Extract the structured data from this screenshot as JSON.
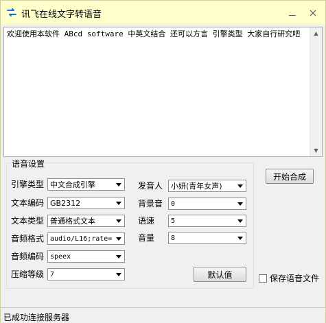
{
  "window": {
    "title": "讯飞在线文字转语音",
    "minimize_glyph": "—",
    "close_glyph": "✕"
  },
  "text_input": {
    "value": "欢迎使用本软件 ABcd software 中英文结合 还可以方言 引擎类型 大家自行研究吧"
  },
  "settings": {
    "group_title": "语音设置",
    "engine": {
      "label": "引擎类型",
      "value": "中文合成引擎"
    },
    "encoding": {
      "label": "文本编码",
      "value": "GB2312"
    },
    "text_type": {
      "label": "文本类型",
      "value": "普通格式文本"
    },
    "audio_format": {
      "label": "音频格式",
      "value": "audio/L16;rate="
    },
    "audio_codec": {
      "label": "音频编码",
      "value": "speex"
    },
    "compress_level": {
      "label": "压缩等级",
      "value": "7"
    },
    "voice": {
      "label": "发音人",
      "value": "小妍(青年女声)"
    },
    "background": {
      "label": "背景音",
      "value": "0"
    },
    "speed": {
      "label": "语速",
      "value": "5"
    },
    "volume": {
      "label": "音量",
      "value": "8"
    },
    "default_button": "默认值"
  },
  "actions": {
    "start_button": "开始合成",
    "save_audio_label": "保存语音文件",
    "save_audio_checked": false
  },
  "status": {
    "text": "已成功连接服务器"
  },
  "colors": {
    "titlebar_bg": "#ffffcc",
    "icon_blue": "#1e73d2"
  }
}
